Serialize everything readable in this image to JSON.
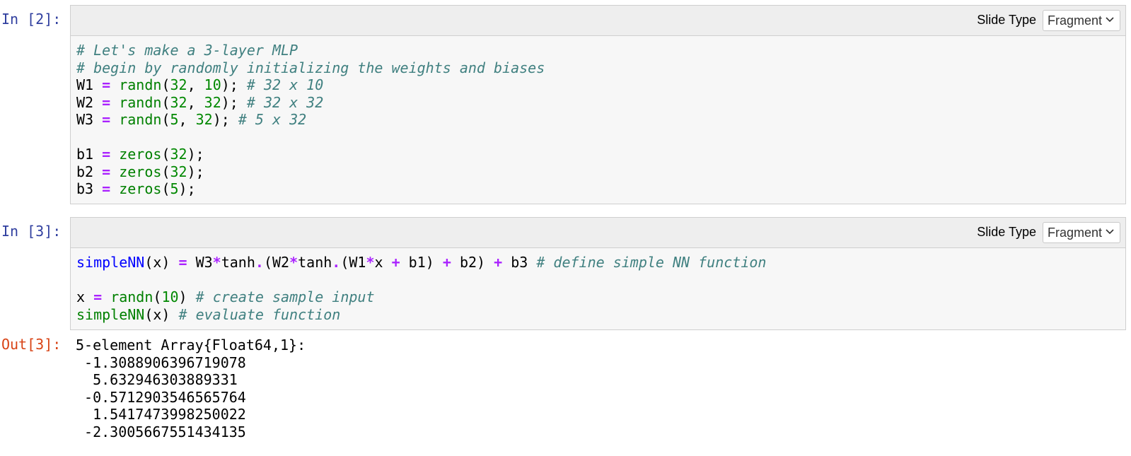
{
  "cells": [
    {
      "prompt": "In [2]:",
      "slide_type_label": "Slide Type",
      "slide_type_value": "Fragment",
      "code_lines": [
        [
          {
            "t": "cm",
            "v": "# Let's make a 3-layer MLP"
          }
        ],
        [
          {
            "t": "cm",
            "v": "# begin by randomly initializing the weights and biases"
          }
        ],
        [
          {
            "t": "",
            "v": "W1 "
          },
          {
            "t": "op",
            "v": "="
          },
          {
            "t": "",
            "v": " "
          },
          {
            "t": "fn",
            "v": "randn"
          },
          {
            "t": "",
            "v": "("
          },
          {
            "t": "num",
            "v": "32"
          },
          {
            "t": "",
            "v": ", "
          },
          {
            "t": "num",
            "v": "10"
          },
          {
            "t": "",
            "v": "); "
          },
          {
            "t": "cm",
            "v": "# 32 x 10"
          }
        ],
        [
          {
            "t": "",
            "v": "W2 "
          },
          {
            "t": "op",
            "v": "="
          },
          {
            "t": "",
            "v": " "
          },
          {
            "t": "fn",
            "v": "randn"
          },
          {
            "t": "",
            "v": "("
          },
          {
            "t": "num",
            "v": "32"
          },
          {
            "t": "",
            "v": ", "
          },
          {
            "t": "num",
            "v": "32"
          },
          {
            "t": "",
            "v": "); "
          },
          {
            "t": "cm",
            "v": "# 32 x 32"
          }
        ],
        [
          {
            "t": "",
            "v": "W3 "
          },
          {
            "t": "op",
            "v": "="
          },
          {
            "t": "",
            "v": " "
          },
          {
            "t": "fn",
            "v": "randn"
          },
          {
            "t": "",
            "v": "("
          },
          {
            "t": "num",
            "v": "5"
          },
          {
            "t": "",
            "v": ", "
          },
          {
            "t": "num",
            "v": "32"
          },
          {
            "t": "",
            "v": "); "
          },
          {
            "t": "cm",
            "v": "# 5 x 32"
          }
        ],
        [],
        [
          {
            "t": "",
            "v": "b1 "
          },
          {
            "t": "op",
            "v": "="
          },
          {
            "t": "",
            "v": " "
          },
          {
            "t": "fn",
            "v": "zeros"
          },
          {
            "t": "",
            "v": "("
          },
          {
            "t": "num",
            "v": "32"
          },
          {
            "t": "",
            "v": ");"
          }
        ],
        [
          {
            "t": "",
            "v": "b2 "
          },
          {
            "t": "op",
            "v": "="
          },
          {
            "t": "",
            "v": " "
          },
          {
            "t": "fn",
            "v": "zeros"
          },
          {
            "t": "",
            "v": "("
          },
          {
            "t": "num",
            "v": "32"
          },
          {
            "t": "",
            "v": ");"
          }
        ],
        [
          {
            "t": "",
            "v": "b3 "
          },
          {
            "t": "op",
            "v": "="
          },
          {
            "t": "",
            "v": " "
          },
          {
            "t": "fn",
            "v": "zeros"
          },
          {
            "t": "",
            "v": "("
          },
          {
            "t": "num",
            "v": "5"
          },
          {
            "t": "",
            "v": ");"
          }
        ]
      ]
    },
    {
      "prompt": "In [3]:",
      "slide_type_label": "Slide Type",
      "slide_type_value": "Fragment",
      "code_lines": [
        [
          {
            "t": "fnd",
            "v": "simpleNN"
          },
          {
            "t": "",
            "v": "(x) "
          },
          {
            "t": "op",
            "v": "="
          },
          {
            "t": "",
            "v": " W3"
          },
          {
            "t": "op",
            "v": "*"
          },
          {
            "t": "",
            "v": "tanh"
          },
          {
            "t": "op",
            "v": "."
          },
          {
            "t": "",
            "v": "(W2"
          },
          {
            "t": "op",
            "v": "*"
          },
          {
            "t": "",
            "v": "tanh"
          },
          {
            "t": "op",
            "v": "."
          },
          {
            "t": "",
            "v": "(W1"
          },
          {
            "t": "op",
            "v": "*"
          },
          {
            "t": "",
            "v": "x "
          },
          {
            "t": "op",
            "v": "+"
          },
          {
            "t": "",
            "v": " b1) "
          },
          {
            "t": "op",
            "v": "+"
          },
          {
            "t": "",
            "v": " b2) "
          },
          {
            "t": "op",
            "v": "+"
          },
          {
            "t": "",
            "v": " b3 "
          },
          {
            "t": "cm",
            "v": "# define simple NN function"
          }
        ],
        [],
        [
          {
            "t": "",
            "v": "x "
          },
          {
            "t": "op",
            "v": "="
          },
          {
            "t": "",
            "v": " "
          },
          {
            "t": "fn",
            "v": "randn"
          },
          {
            "t": "",
            "v": "("
          },
          {
            "t": "num",
            "v": "10"
          },
          {
            "t": "",
            "v": ") "
          },
          {
            "t": "cm",
            "v": "# create sample input"
          }
        ],
        [
          {
            "t": "fn",
            "v": "simpleNN"
          },
          {
            "t": "",
            "v": "(x) "
          },
          {
            "t": "cm",
            "v": "# evaluate function"
          }
        ]
      ]
    }
  ],
  "output": {
    "prompt": "Out[3]:",
    "lines": [
      "5-element Array{Float64,1}:",
      " -1.3088906396719078",
      "  5.632946303889331",
      " -0.5712903546565764",
      "  1.5417473998250022",
      " -2.3005667551434135"
    ]
  },
  "icons": {
    "dropdown": "chevron-down-icon"
  }
}
